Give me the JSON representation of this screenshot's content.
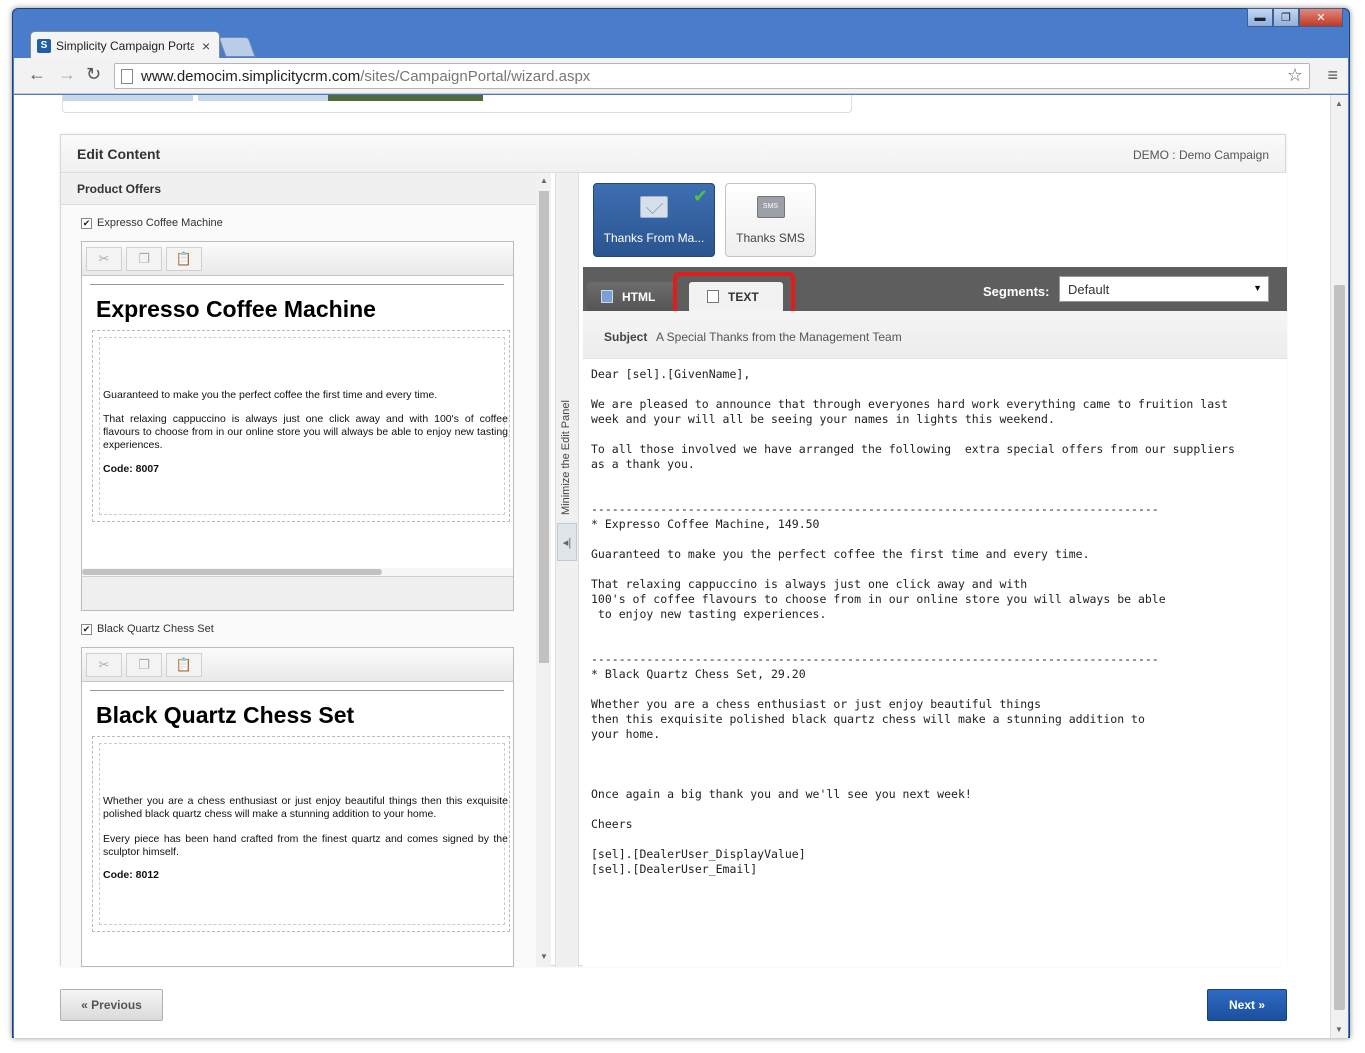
{
  "browser": {
    "tab_title": "Simplicity Campaign Porta",
    "tab_close": "×",
    "favicon_letter": "S",
    "url_domain": "www.democim.simplicitycrm.com",
    "url_path": "/sites/CampaignPortal/wizard.aspx",
    "back": "←",
    "forward": "→",
    "reload": "↻",
    "star": "☆",
    "menu": "≡",
    "minimize": "▬",
    "maximize": "❐",
    "close": "✕"
  },
  "card": {
    "title": "Edit Content",
    "campaign": "DEMO : Demo Campaign"
  },
  "left": {
    "heading": "Product Offers",
    "offers": [
      {
        "check_label": "Expresso Coffee Machine",
        "title": "Expresso Coffee Machine",
        "p1": "Guaranteed to make you the perfect coffee the first time and every time.",
        "p2": "That relaxing cappuccino is always just one click away and with 100's of coffee flavours to choose from in our online store you will always be able to enjoy new tasting experiences.",
        "code": "Code: 8007"
      },
      {
        "check_label": "Black Quartz Chess Set",
        "title": "Black Quartz Chess Set",
        "p1": "Whether you are a chess enthusiast or just enjoy beautiful things then this exquisite polished black quartz chess will make a stunning addition to your home.",
        "p2": "Every piece has been hand crafted from the finest quartz and comes signed by the sculptor himself.",
        "code": "Code: 8012"
      }
    ],
    "tools": {
      "cut": "✂",
      "copy": "❐",
      "paste": "📋"
    },
    "check": "✔"
  },
  "minimize_panel": {
    "label": "Minimize the Edit Panel",
    "arrow": "◂|"
  },
  "right": {
    "messages": [
      {
        "label": "Thanks From Ma...",
        "checked": "✔"
      },
      {
        "label": "Thanks SMS",
        "icon_text": "SMS"
      }
    ],
    "tabs": {
      "html": "HTML",
      "text": "TEXT"
    },
    "segments_label": "Segments:",
    "segments_value": "Default",
    "segments_arrow": "▼",
    "subject_label": "Subject",
    "subject_value": "A Special Thanks from the Management Team",
    "body": "Dear [sel].[GivenName],\n\nWe are pleased to announce that through everyones hard work everything came to fruition last\nweek and your will all be seeing your names in lights this weekend.\n\nTo all those involved we have arranged the following  extra special offers from our suppliers\nas a thank you.\n\n\n----------------------------------------------------------------------------------\n* Expresso Coffee Machine, 149.50\n\nGuaranteed to make you the perfect coffee the first time and every time.\n\nThat relaxing cappuccino is always just one click away and with\n100's of coffee flavours to choose from in our online store you will always be able\n to enjoy new tasting experiences.\n\n\n----------------------------------------------------------------------------------\n* Black Quartz Chess Set, 29.20\n\nWhether you are a chess enthusiast or just enjoy beautiful things\nthen this exquisite polished black quartz chess will make a stunning addition to\nyour home.\n\n\n\nOnce again a big thank you and we'll see you next week!\n\nCheers\n\n[sel].[DealerUser_DisplayValue]\n[sel].[DealerUser_Email]"
  },
  "footer": {
    "previous": "« Previous",
    "next": "Next »"
  },
  "colors": {
    "accent_blue": "#2a548f",
    "highlight_red": "#e21b1b",
    "tabbar_gray": "#5e5e5e"
  }
}
